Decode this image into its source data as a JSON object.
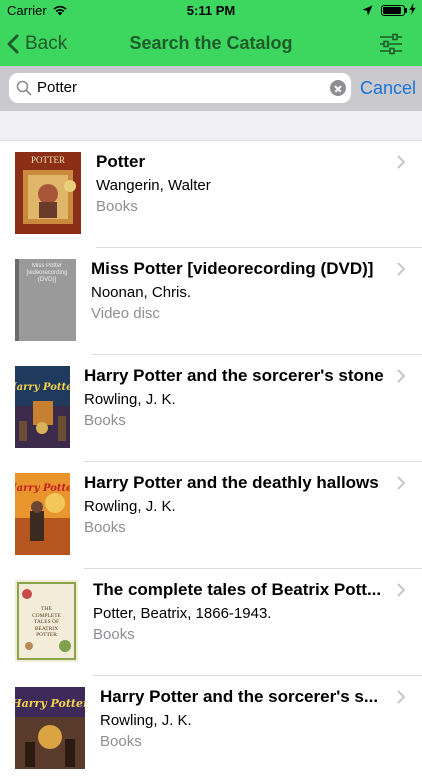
{
  "status": {
    "carrier": "Carrier",
    "time": "5:11 PM",
    "battery_level": 0.9
  },
  "nav": {
    "back_label": "Back",
    "title": "Search the Catalog"
  },
  "search": {
    "value": "Potter",
    "cancel_label": "Cancel"
  },
  "results": [
    {
      "title": "Potter",
      "author": "Wangerin, Walter",
      "format": "Books",
      "cover_text": "POTTER"
    },
    {
      "title": "Miss Potter [videorecording (DVD)]",
      "author": "Noonan, Chris.",
      "format": "Video disc",
      "cover_text": "Miss Potter [videorecording (DVD)]"
    },
    {
      "title": "Harry Potter and the sorcerer's stone",
      "author": "Rowling, J. K.",
      "format": "Books",
      "cover_text": "Harry Potter"
    },
    {
      "title": "Harry Potter and the deathly hallows",
      "author": "Rowling, J. K.",
      "format": "Books",
      "cover_text": "Harry Potter"
    },
    {
      "title": "The complete tales of Beatrix Pott...",
      "author": "Potter, Beatrix, 1866-1943.",
      "format": "Books",
      "cover_text": "THE COMPLETE TALES OF BEATRIX POTTER"
    },
    {
      "title": "Harry Potter and the sorcerer's s...",
      "author": "Rowling, J. K.",
      "format": "Books",
      "cover_text": "Harry Potter"
    }
  ]
}
